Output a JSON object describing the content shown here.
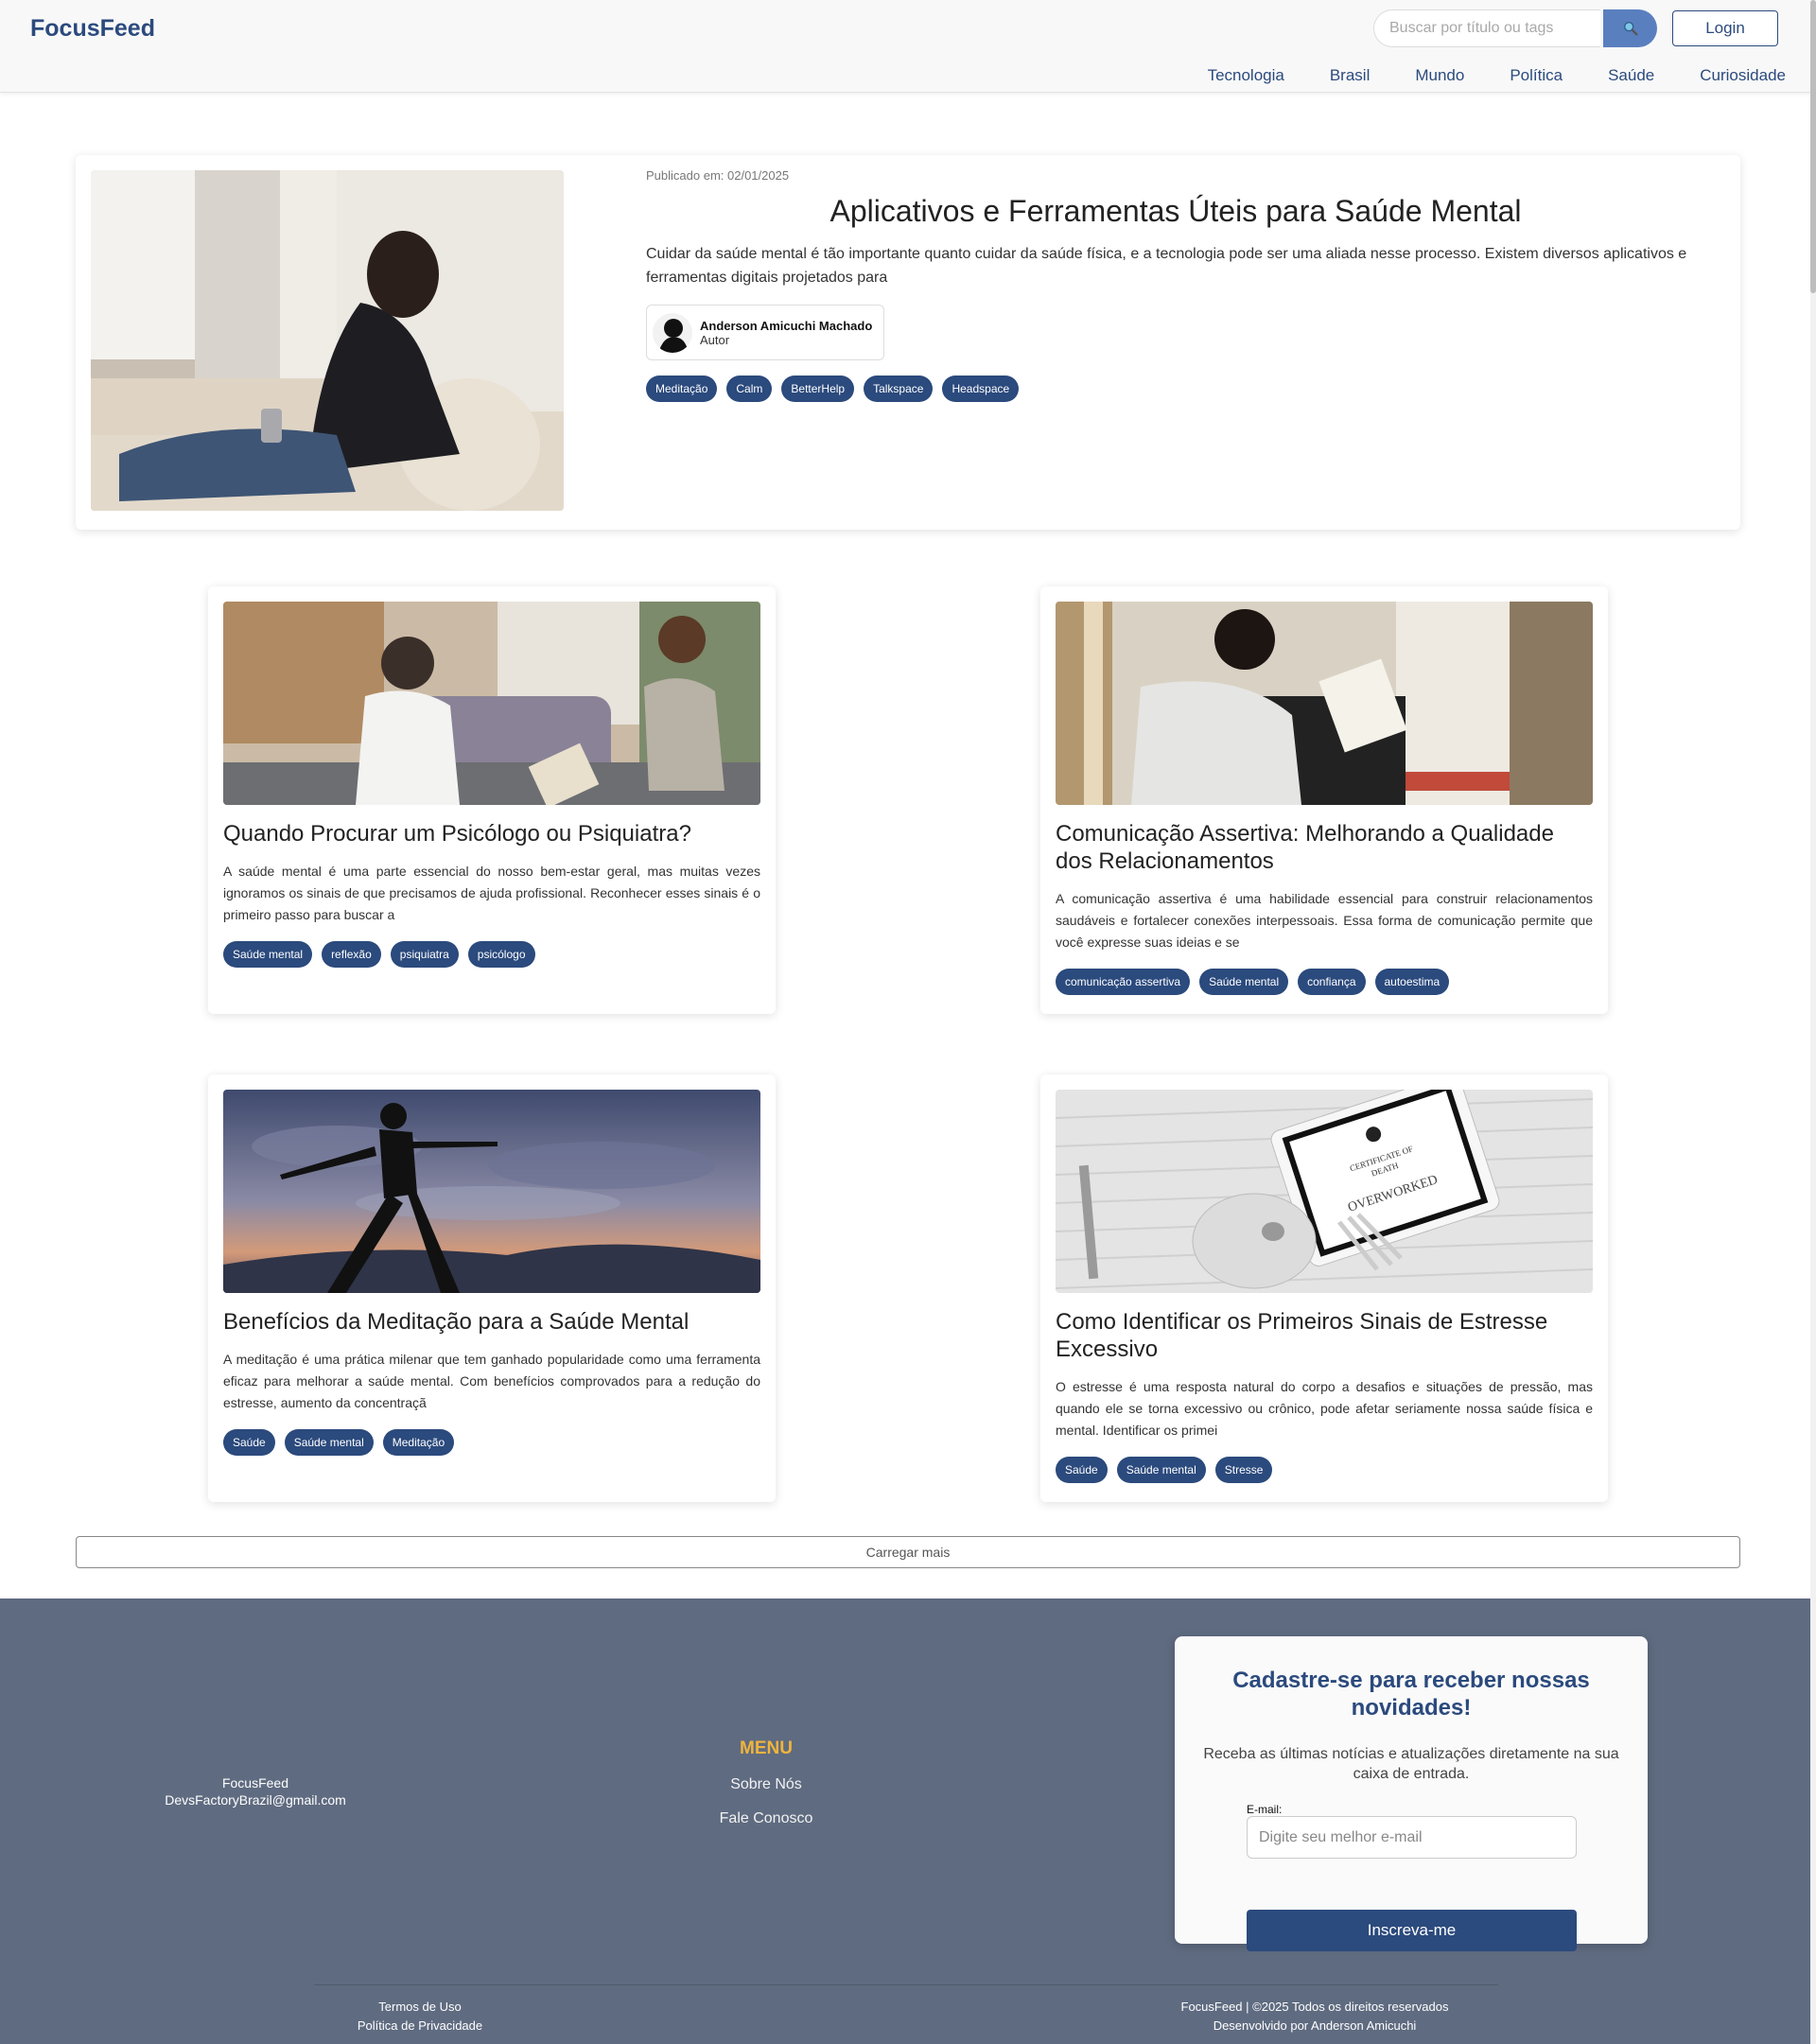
{
  "header": {
    "logo": "FocusFeed",
    "search_placeholder": "Buscar por título ou tags",
    "login_label": "Login",
    "nav": [
      "Tecnologia",
      "Brasil",
      "Mundo",
      "Política",
      "Saúde",
      "Curiosidade"
    ]
  },
  "featured": {
    "published": "Publicado em: 02/01/2025",
    "title": "Aplicativos e Ferramentas Úteis para Saúde Mental",
    "excerpt": "Cuidar da saúde mental é tão importante quanto cuidar da saúde física, e a tecnologia pode ser uma aliada nesse processo. Existem diversos aplicativos e ferramentas digitais projetados para",
    "author_name": "Anderson Amicuchi Machado",
    "author_role": "Autor",
    "tags": [
      "Meditação",
      "Calm",
      "BetterHelp",
      "Talkspace",
      "Headspace"
    ]
  },
  "cards": [
    {
      "title": "Quando Procurar um Psicólogo ou Psiquiatra?",
      "excerpt": "A saúde mental é uma parte essencial do nosso bem-estar geral, mas muitas vezes ignoramos os sinais de que precisamos de ajuda profissional. Reconhecer esses sinais é o primeiro passo para buscar a",
      "tags": [
        "Saúde mental",
        "reflexão",
        "psiquiatra",
        "psicólogo"
      ]
    },
    {
      "title": "Comunicação Assertiva: Melhorando a Qualidade dos Relacionamentos",
      "excerpt": "A comunicação assertiva é uma habilidade essencial para construir relacionamentos saudáveis e fortalecer conexões interpessoais. Essa forma de comunicação permite que você expresse suas ideias e se",
      "tags": [
        "comunicação assertiva",
        "Saúde mental",
        "confiança",
        "autoestima"
      ]
    },
    {
      "title": "Benefícios da Meditação para a Saúde Mental",
      "excerpt": "A meditação é uma prática milenar que tem ganhado popularidade como uma ferramenta eficaz para melhorar a saúde mental. Com benefícios comprovados para a redução do estresse, aumento da concentraçã",
      "tags": [
        "Saúde",
        "Saúde mental",
        "Meditação"
      ]
    },
    {
      "title": "Como Identificar os Primeiros Sinais de Estresse Excessivo",
      "excerpt": "O estresse é uma resposta natural do corpo a desafios e situações de pressão, mas quando ele se torna excessivo ou crônico, pode afetar seriamente nossa saúde física e mental. Identificar os primei",
      "tags": [
        "Saúde",
        "Saúde mental",
        "Stresse"
      ]
    }
  ],
  "load_more": "Carregar mais",
  "footer": {
    "brand": "FocusFeed",
    "email": "DevsFactoryBrazil@gmail.com",
    "menu_title": "MENU",
    "menu_items": [
      "Sobre Nós",
      "Fale Conosco"
    ],
    "newsletter_title": "Cadastre-se para receber nossas novidades!",
    "newsletter_text": "Receba as últimas notícias e atualizações diretamente na sua caixa de entrada.",
    "email_label": "E-mail:",
    "email_placeholder": "Digite seu melhor e-mail",
    "subscribe_label": "Inscreva-me",
    "terms": "Termos de Uso",
    "privacy": "Política de Privacidade",
    "copyright": "FocusFeed | ©2025 Todos os direitos reservados",
    "developer": "Desenvolvido por Anderson Amicuchi"
  }
}
